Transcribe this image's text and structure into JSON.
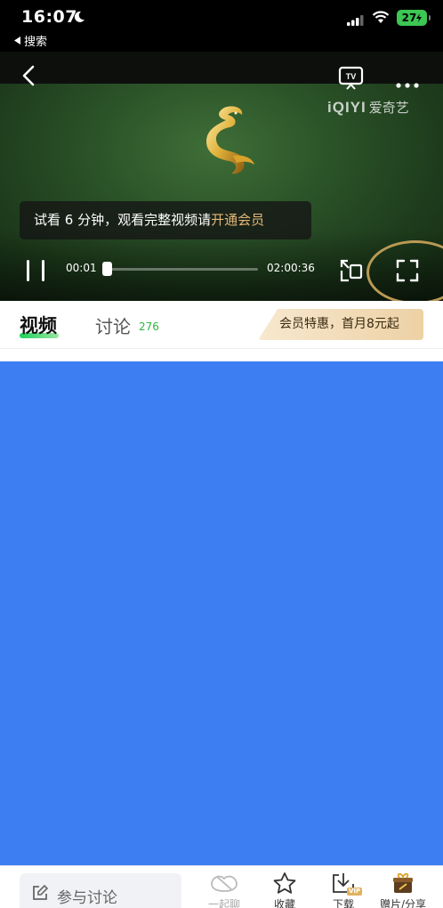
{
  "status_bar": {
    "time": "16:07",
    "back_app": "搜索",
    "battery": "27"
  },
  "player": {
    "logo_text": "iQIYI",
    "logo_cn": "爱奇艺",
    "trial_tip_prefix": "试看 6 分钟，观看完整视频请",
    "trial_tip_link": "开通会员",
    "current_time": "00:01",
    "total_time": "02:00:36",
    "progress_fraction": 0.0
  },
  "tabs": {
    "video": "视频",
    "discuss": "讨论",
    "discuss_count": "276",
    "vip_banner": "会员特惠，首月8元起"
  },
  "bottom_bar": {
    "comment_placeholder": "参与讨论",
    "watch_together": "一起聊",
    "favorite": "收藏",
    "download": "下载",
    "download_badge": "VIP",
    "share": "赠片/分享"
  },
  "colors": {
    "content_bg": "#3d7ff3",
    "accent_green": "#2db53f",
    "vip_gold": "#e2b876",
    "battery_green": "#3cc653"
  },
  "icons": [
    "moon-icon",
    "signal-icon",
    "wifi-icon",
    "back-icon",
    "tv-cast-icon",
    "more-icon",
    "pause-icon",
    "rotate-icon",
    "fullscreen-icon",
    "edit-icon",
    "chat-together-icon",
    "star-icon",
    "download-icon",
    "gift-icon"
  ]
}
